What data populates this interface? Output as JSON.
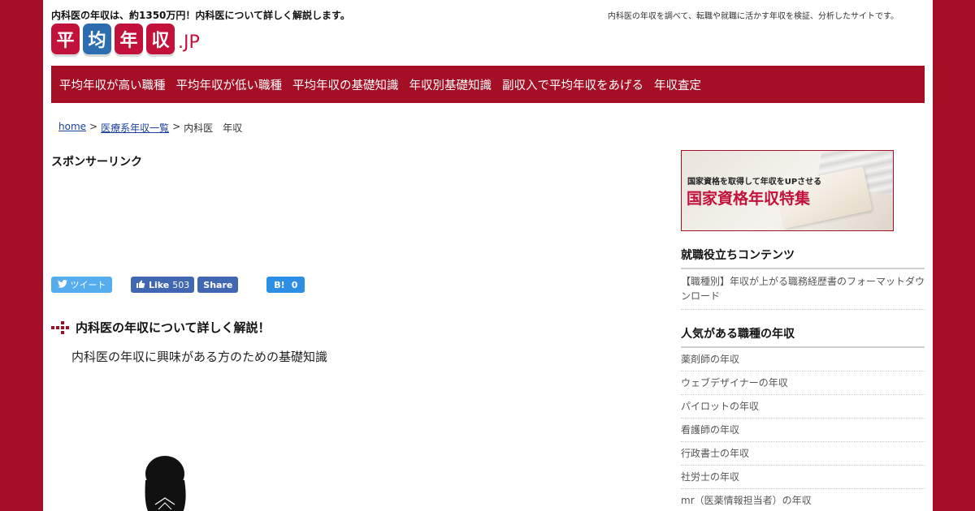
{
  "header": {
    "tagline": "内科医の年収は、約1350万円！内科医について詳しく解説します。",
    "site_description": "内科医の年収を調べて、転職や就職に活かす年収を検証、分析したサイトです。",
    "logo": {
      "tiles": [
        "平",
        "均",
        "年",
        "収"
      ],
      "suffix": ".JP"
    }
  },
  "nav": {
    "items": [
      "平均年収が高い職種",
      "平均年収が低い職種",
      "平均年収の基礎知識",
      "年収別基礎知識",
      "副収入で平均年収をあげる",
      "年収査定"
    ]
  },
  "breadcrumb": {
    "home": "home",
    "separator": ">",
    "category": "医療系年収一覧",
    "current": "内科医　年収"
  },
  "main": {
    "sponsor_label": "スポンサーリンク",
    "share": {
      "tweet_label": "ツイート",
      "like_label": "Like",
      "like_count": "503",
      "share_label": "Share",
      "hatena_label": "B!",
      "hatena_count": "0"
    },
    "section_title": "内科医の年収について詳しく解説！",
    "subtitle": "内科医の年収に興味がある方のための基礎知識"
  },
  "sidebar": {
    "banner": {
      "small_text": "国家資格を取得して年収をUPさせる",
      "big_text": "国家資格年収特集"
    },
    "content_heading": "就職役立ちコンテンツ",
    "content_item": "【職種別】年収が上がる職務経歴書のフォーマットダウンロード",
    "popular_heading": "人気がある職種の年収",
    "popular_items": [
      "薬剤師の年収",
      "ウェブデザイナーの年収",
      "パイロットの年収",
      "看護師の年収",
      "行政書士の年収",
      "社労士の年収",
      "mr（医薬情報担当者）の年収"
    ]
  },
  "colors": {
    "brand_red": "#a50f26",
    "logo_red": "#c2113a",
    "logo_blue": "#2b6dae",
    "twitter": "#55acee",
    "facebook": "#4267b2",
    "hatena": "#2c8ee5"
  }
}
